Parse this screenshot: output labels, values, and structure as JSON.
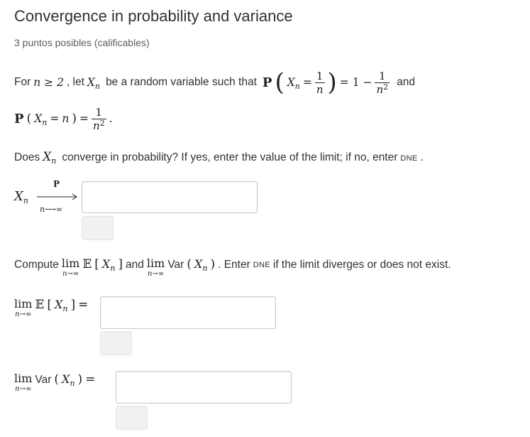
{
  "problem": {
    "title": "Convergence in probability and variance",
    "points": "3 puntos posibles (calificables)"
  },
  "statement": {
    "for": "For",
    "n_geq_2": "n ≥ 2",
    "comma_let": ", let",
    "rv_text": "be a random variable such that",
    "P": "P",
    "X": "X",
    "n": "n",
    "eq": "=",
    "one": "1",
    "one_minus": "= 1 −",
    "n_sq_base": "n",
    "sq": "2",
    "and": "and",
    "period": "."
  },
  "q1": {
    "prefix": "Does",
    "suffix": "converge in probability? If yes, enter the value of the limit; if no, enter",
    "dne": "DNE",
    "end": ".",
    "arrow_top": "P",
    "arrow_bottom": "n⟶∞"
  },
  "q2": {
    "compute": "Compute",
    "lim": "lim",
    "lim_under": "n→∞",
    "E": "𝔼",
    "and": "and",
    "var": "Var",
    "after": ". Enter",
    "dne": "DNE",
    "tail": "if the limit diverges or does not exist.",
    "eq": "="
  }
}
